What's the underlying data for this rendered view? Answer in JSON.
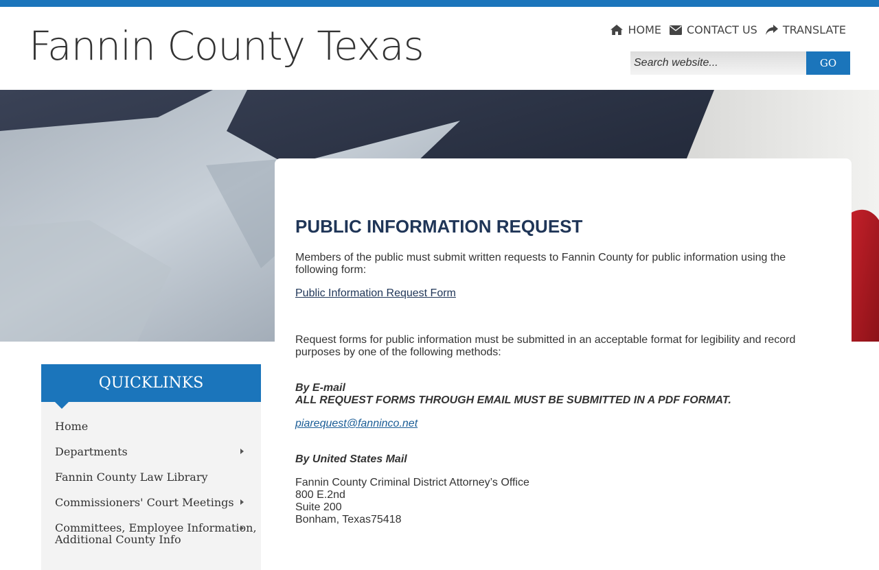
{
  "header": {
    "site_title": "Fannin County Texas",
    "nav": [
      {
        "icon": "home-icon",
        "label": "HOME"
      },
      {
        "icon": "envelope-icon",
        "label": "CONTACT US"
      },
      {
        "icon": "share-icon",
        "label": "TRANSLATE"
      }
    ],
    "search": {
      "placeholder": "Search website...",
      "button_label": "GO"
    }
  },
  "colors": {
    "accent": "#1b75bb",
    "title": "#1f3557",
    "text": "#333333"
  },
  "main": {
    "title": "PUBLIC INFORMATION REQUEST",
    "intro": "Members of the public must submit written requests to Fannin County for public information using the following form:",
    "form_link": "Public Information Request Form",
    "methods_intro": "Request forms for public information must be submitted in an acceptable format for legibility and record purposes by one of the following methods:",
    "email_heading": "By E-mail",
    "email_note": "ALL REQUEST FORMS THROUGH EMAIL MUST BE SUBMITTED IN A PDF FORMAT.",
    "email_address": "piarequest@fanninco.net",
    "mail_heading": "By United States Mail",
    "address": [
      "Fannin County Criminal District Attorney’s Office",
      "800 E.2nd",
      "Suite 200",
      "Bonham, Texas75418"
    ]
  },
  "sidebar": {
    "heading": "QUICKLINKS",
    "items": [
      {
        "label": "Home",
        "has_submenu": false
      },
      {
        "label": "Departments",
        "has_submenu": true
      },
      {
        "label": "Fannin County Law Library",
        "has_submenu": false
      },
      {
        "label": "Commissioners' Court Meetings",
        "has_submenu": true
      },
      {
        "label_line1": "Committees, Employee Information,",
        "label_line2": "Additional County Info",
        "has_submenu": true
      }
    ]
  }
}
